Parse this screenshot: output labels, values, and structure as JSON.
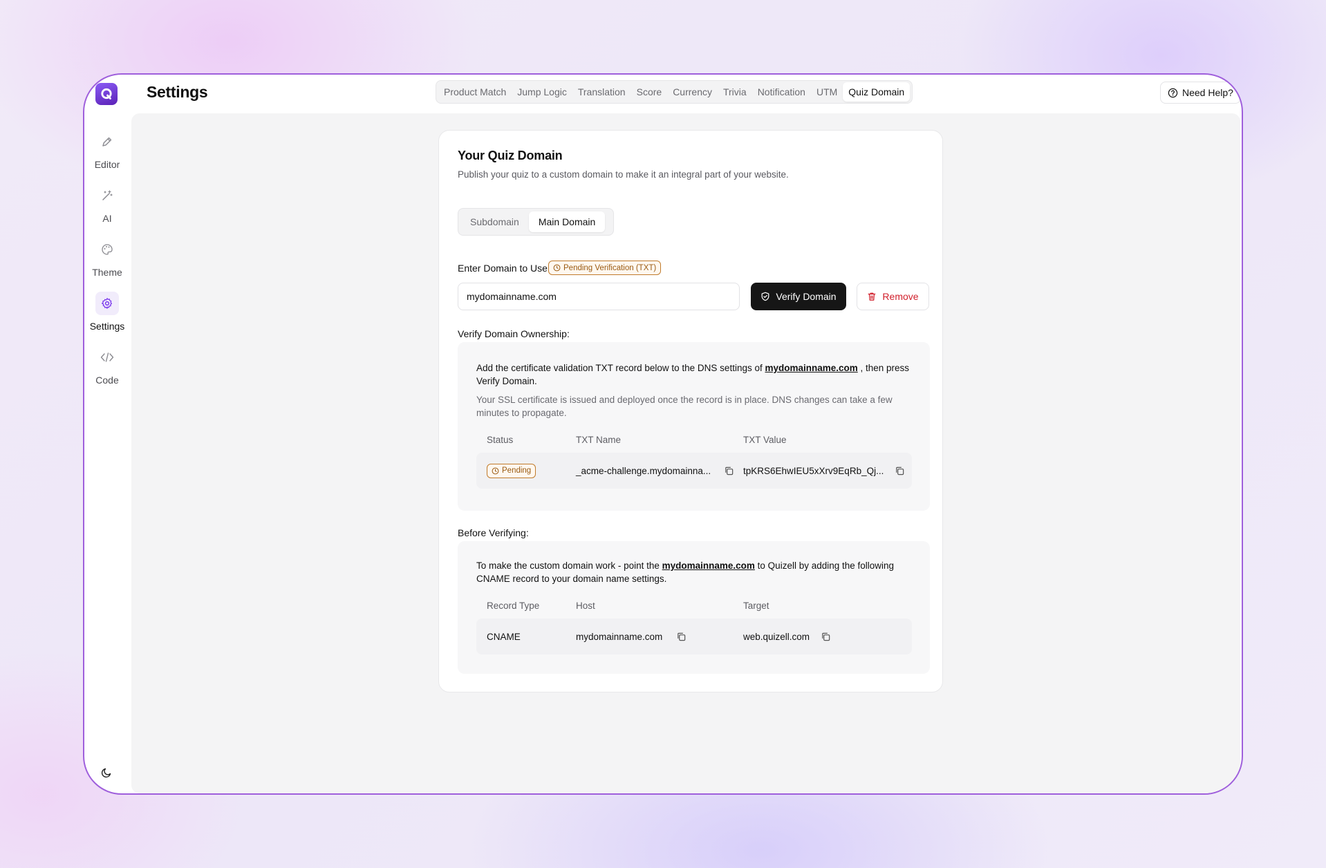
{
  "header": {
    "logo_letter": "Q",
    "title": "Settings",
    "tabs": [
      {
        "label": "Product Match"
      },
      {
        "label": "Jump Logic"
      },
      {
        "label": "Translation"
      },
      {
        "label": "Score"
      },
      {
        "label": "Currency"
      },
      {
        "label": "Trivia"
      },
      {
        "label": "Notification"
      },
      {
        "label": "UTM"
      },
      {
        "label": "Quiz Domain",
        "active": true
      }
    ],
    "help_label": "Need Help?"
  },
  "sidebar": {
    "items": [
      {
        "label": "Editor",
        "icon": "pen-icon"
      },
      {
        "label": "AI",
        "icon": "magic-wand-icon"
      },
      {
        "label": "Theme",
        "icon": "palette-icon"
      },
      {
        "label": "Settings",
        "icon": "gear-icon",
        "active": true
      },
      {
        "label": "Code",
        "icon": "code-icon"
      }
    ],
    "theme_toggle_icon": "moon-icon"
  },
  "card": {
    "title": "Your Quiz Domain",
    "subtitle": "Publish your quiz to a custom domain to make it an integral part of your website.",
    "segments": [
      {
        "label": "Subdomain",
        "active": false
      },
      {
        "label": "Main Domain",
        "active": true
      }
    ],
    "field_label": "Enter Domain to Use",
    "status_badge": "Pending Verification (TXT)",
    "domain_value": "mydomainname.com",
    "verify_label": "Verify Domain",
    "remove_label": "Remove"
  },
  "verify_section": {
    "title": "Verify Domain Ownership:",
    "text_before": "Add the certificate validation TXT record below to the DNS settings of ",
    "link": "mydomainname.com",
    "text_after": " , then press Verify Domain.",
    "note": "Your SSL certificate is issued and deployed once the record is in place. DNS changes can take a few minutes to propagate.",
    "columns": [
      "Status",
      "TXT Name",
      "TXT Value"
    ],
    "row": {
      "status": "Pending",
      "txt_name": "_acme-challenge.mydomainna...",
      "txt_value": "tpKRS6EhwIEU5xXrv9EqRb_Qj..."
    }
  },
  "before_section": {
    "title": "Before Verifying:",
    "text_before": "To make the custom domain work - point the ",
    "link": "mydomainname.com",
    "text_after": " to Quizell by adding the following CNAME record to your domain name settings.",
    "columns": [
      "Record Type",
      "Host",
      "Target"
    ],
    "row": {
      "record_type": "CNAME",
      "host": "mydomainname.com",
      "target": "web.quizell.com"
    }
  },
  "colors": {
    "accent": "#7c3aed",
    "window_border": "#9f5fdc",
    "pending": "#9a5a12",
    "danger": "#d11f2b"
  }
}
